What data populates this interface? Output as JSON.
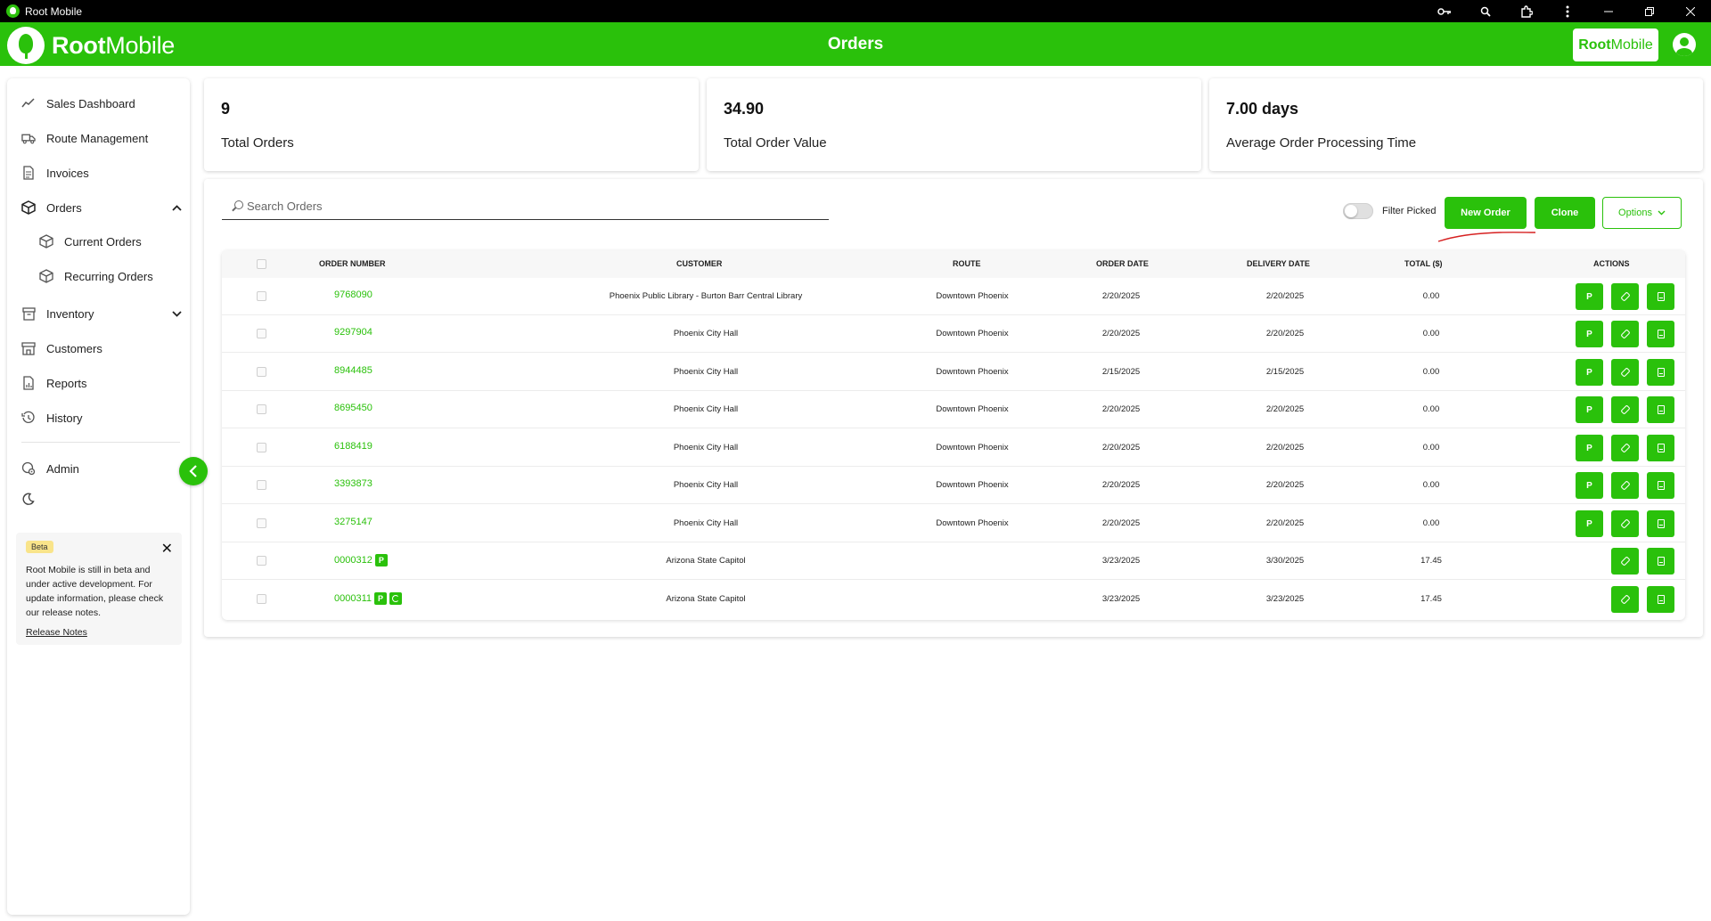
{
  "window": {
    "title": "Root Mobile",
    "icons": [
      "key-icon",
      "zoom-icon",
      "extensions-icon",
      "more-icon",
      "minimize-icon",
      "restore-icon",
      "close-icon"
    ]
  },
  "header": {
    "logo_bold": "Root",
    "logo_regular": "Mobile",
    "title": "Orders",
    "brand_bold": "Root",
    "brand_regular": "Mobile",
    "accent": "#2ac10b"
  },
  "sidebar": {
    "items": [
      {
        "label": "Sales Dashboard",
        "icon": "chart-icon"
      },
      {
        "label": "Route Management",
        "icon": "truck-icon"
      },
      {
        "label": "Invoices",
        "icon": "invoice-icon"
      },
      {
        "label": "Orders",
        "icon": "box-icon",
        "expanded": true
      },
      {
        "label": "Current Orders",
        "icon": "box-icon"
      },
      {
        "label": "Recurring Orders",
        "icon": "box-icon"
      },
      {
        "label": "Inventory",
        "icon": "inventory-icon",
        "expanded": false
      },
      {
        "label": "Customers",
        "icon": "store-icon"
      },
      {
        "label": "Reports",
        "icon": "report-icon"
      },
      {
        "label": "History",
        "icon": "history-icon"
      },
      {
        "label": "Admin",
        "icon": "gear-icon"
      }
    ],
    "beta": {
      "badge": "Beta",
      "text": "Root Mobile is still in beta and under active development. For update information, please check our release notes.",
      "link": "Release Notes"
    }
  },
  "stats": [
    {
      "value": "9",
      "label": "Total Orders"
    },
    {
      "value": "34.90",
      "label": "Total Order Value"
    },
    {
      "value": "7.00 days",
      "label": "Average Order Processing Time"
    }
  ],
  "toolbar": {
    "search_placeholder": "Search Orders",
    "filter_label": "Filter Picked",
    "filter_on": false,
    "new_order": "New Order",
    "clone": "Clone",
    "options": "Options"
  },
  "table": {
    "headers": [
      "Order Number",
      "Customer",
      "Route",
      "Order Date",
      "Delivery Date",
      "Total ($)",
      "Actions"
    ],
    "rows": [
      {
        "order": "9768090",
        "customer": "Phoenix Public Library - Burton Barr Central Library",
        "route": "Downtown Phoenix",
        "order_date": "2/20/2025",
        "delivery_date": "2/20/2025",
        "total": "0.00",
        "badges": [],
        "actions": [
          "P",
          "tag",
          "doc"
        ]
      },
      {
        "order": "9297904",
        "customer": "Phoenix City Hall",
        "route": "Downtown Phoenix",
        "order_date": "2/20/2025",
        "delivery_date": "2/20/2025",
        "total": "0.00",
        "badges": [],
        "actions": [
          "P",
          "tag",
          "doc"
        ]
      },
      {
        "order": "8944485",
        "customer": "Phoenix City Hall",
        "route": "Downtown Phoenix",
        "order_date": "2/15/2025",
        "delivery_date": "2/15/2025",
        "total": "0.00",
        "badges": [],
        "actions": [
          "P",
          "tag",
          "doc"
        ]
      },
      {
        "order": "8695450",
        "customer": "Phoenix City Hall",
        "route": "Downtown Phoenix",
        "order_date": "2/20/2025",
        "delivery_date": "2/20/2025",
        "total": "0.00",
        "badges": [],
        "actions": [
          "P",
          "tag",
          "doc"
        ]
      },
      {
        "order": "6188419",
        "customer": "Phoenix City Hall",
        "route": "Downtown Phoenix",
        "order_date": "2/20/2025",
        "delivery_date": "2/20/2025",
        "total": "0.00",
        "badges": [],
        "actions": [
          "P",
          "tag",
          "doc"
        ]
      },
      {
        "order": "3393873",
        "customer": "Phoenix City Hall",
        "route": "Downtown Phoenix",
        "order_date": "2/20/2025",
        "delivery_date": "2/20/2025",
        "total": "0.00",
        "badges": [],
        "actions": [
          "P",
          "tag",
          "doc"
        ]
      },
      {
        "order": "3275147",
        "customer": "Phoenix City Hall",
        "route": "Downtown Phoenix",
        "order_date": "2/20/2025",
        "delivery_date": "2/20/2025",
        "total": "0.00",
        "badges": [],
        "actions": [
          "P",
          "tag",
          "doc"
        ]
      },
      {
        "order": "0000312",
        "customer": "Arizona State Capitol",
        "route": "",
        "order_date": "3/23/2025",
        "delivery_date": "3/30/2025",
        "total": "17.45",
        "badges": [
          "P"
        ],
        "actions": [
          "tag",
          "doc"
        ]
      },
      {
        "order": "0000311",
        "customer": "Arizona State Capitol",
        "route": "",
        "order_date": "3/23/2025",
        "delivery_date": "3/23/2025",
        "total": "17.45",
        "badges": [
          "P",
          "recurring"
        ],
        "actions": [
          "tag",
          "doc"
        ]
      }
    ]
  }
}
